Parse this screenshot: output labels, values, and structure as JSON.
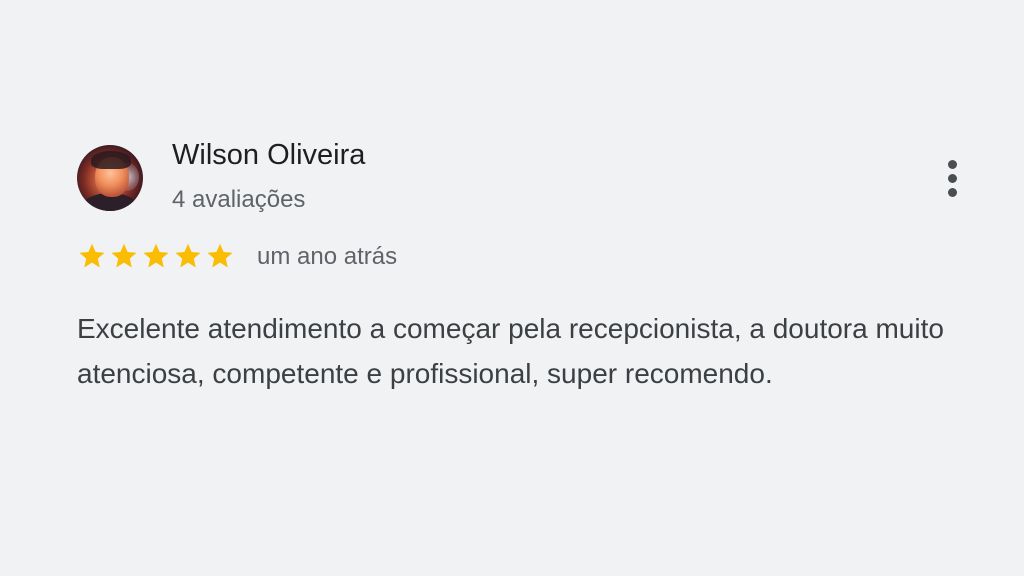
{
  "review": {
    "author_name": "Wilson Oliveira",
    "review_count": "4 avaliações",
    "rating": 5,
    "max_rating": 5,
    "time_ago": "um ano atrás",
    "text": "Excelente atendimento a começar pela recepcionista, a doutora muito atenciosa, competente e profissional, super recomendo."
  },
  "icons": {
    "more": "more-vert-icon",
    "star": "star-icon",
    "avatar": "profile-photo"
  },
  "colors": {
    "background": "#f1f2f4",
    "star": "#fbbc04",
    "name_text": "#1f1f1f",
    "secondary_text": "#5f6368",
    "body_text": "#3c4043"
  }
}
